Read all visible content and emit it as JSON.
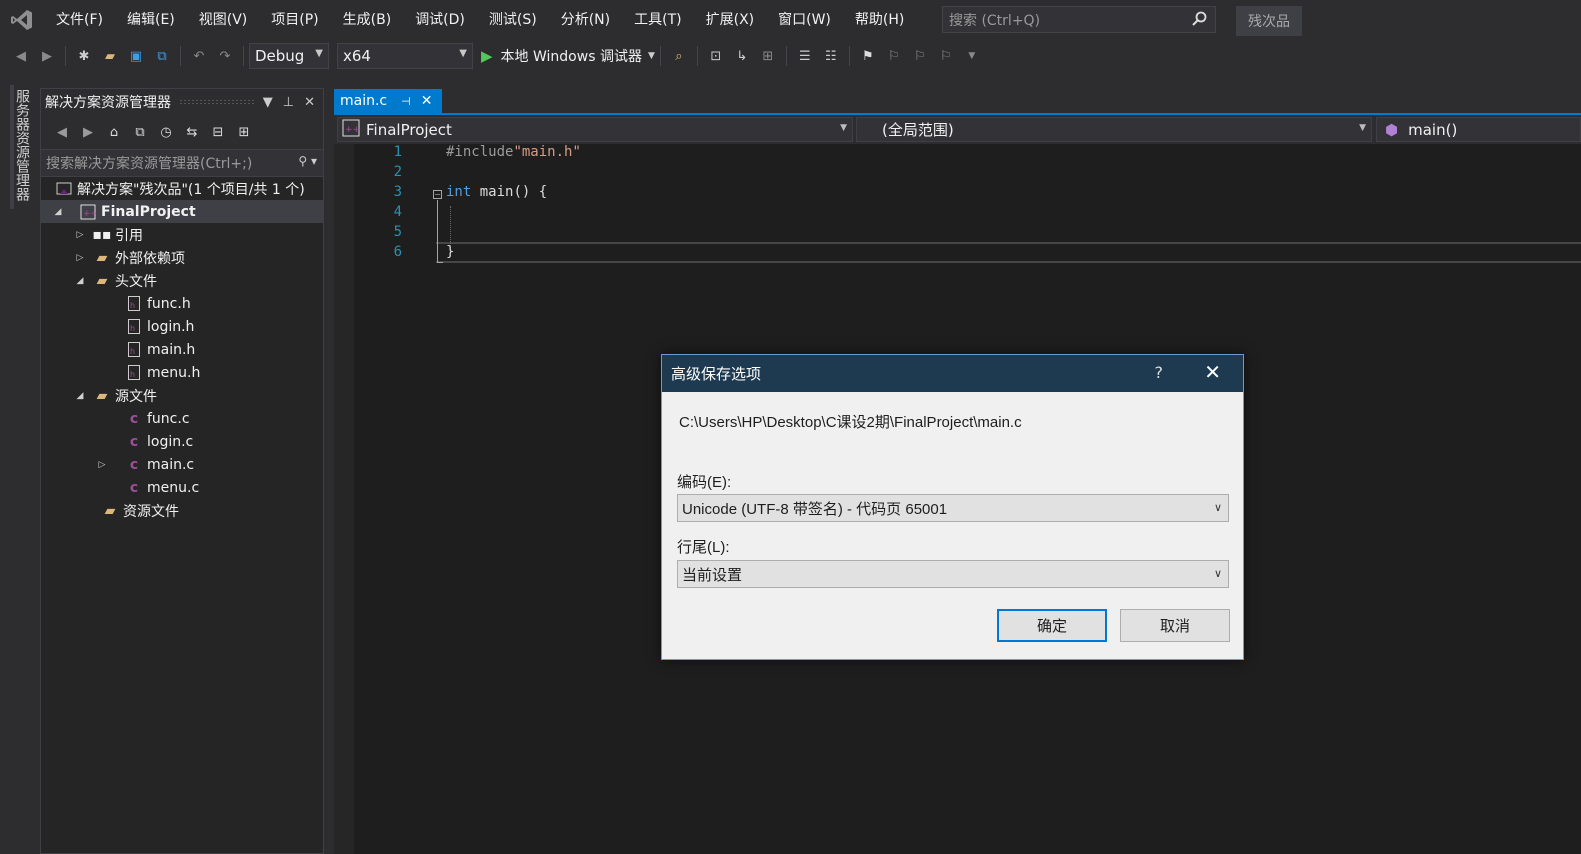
{
  "menubar": {
    "items": [
      "文件(F)",
      "编辑(E)",
      "视图(V)",
      "项目(P)",
      "生成(B)",
      "调试(D)",
      "测试(S)",
      "分析(N)",
      "工具(T)",
      "扩展(X)",
      "窗口(W)",
      "帮助(H)"
    ],
    "search_placeholder": "搜索 (Ctrl+Q)",
    "solution_badge": "残次品"
  },
  "toolbar": {
    "config": "Debug",
    "platform": "x64",
    "run_label": "本地 Windows 调试器"
  },
  "side_strip": {
    "tab_label": "服务器资源管理器"
  },
  "solution_explorer": {
    "title": "解决方案资源管理器",
    "search_placeholder": "搜索解决方案资源管理器(Ctrl+;)",
    "solution_label": "解决方案\"残次品\"(1 个项目/共 1 个)",
    "project": "FinalProject",
    "nodes": {
      "references": "引用",
      "external": "外部依赖项",
      "headers": "头文件",
      "sources": "源文件",
      "resources": "资源文件"
    },
    "header_files": [
      "func.h",
      "login.h",
      "main.h",
      "menu.h"
    ],
    "source_files": [
      "func.c",
      "login.c",
      "main.c",
      "menu.c"
    ]
  },
  "editor": {
    "tab_label": "main.c",
    "nav_project": "FinalProject",
    "nav_scope": "(全局范围)",
    "nav_member": "main()",
    "line_numbers": [
      "1",
      "2",
      "3",
      "4",
      "5",
      "6"
    ],
    "code": {
      "line1_directive": "#include",
      "line1_string": "\"main.h\"",
      "line3_keyword": "int",
      "line3_rest": " main() {",
      "line6": "}"
    }
  },
  "dialog": {
    "title": "高级保存选项",
    "help": "?",
    "path": "C:\\Users\\HP\\Desktop\\C课设2期\\FinalProject\\main.c",
    "encoding_label": "编码(E):",
    "encoding_value": "Unicode (UTF-8 带签名) - 代码页 65001",
    "line_ending_label": "行尾(L):",
    "line_ending_value": "当前设置",
    "ok_label": "确定",
    "cancel_label": "取消"
  },
  "colors": {
    "accent": "#007acc",
    "dialog_title_bg": "#1e3a50",
    "editor_bg": "#1e1e1e",
    "line_number": "#2b91af",
    "keyword": "#569cd6",
    "string": "#d69d85"
  }
}
